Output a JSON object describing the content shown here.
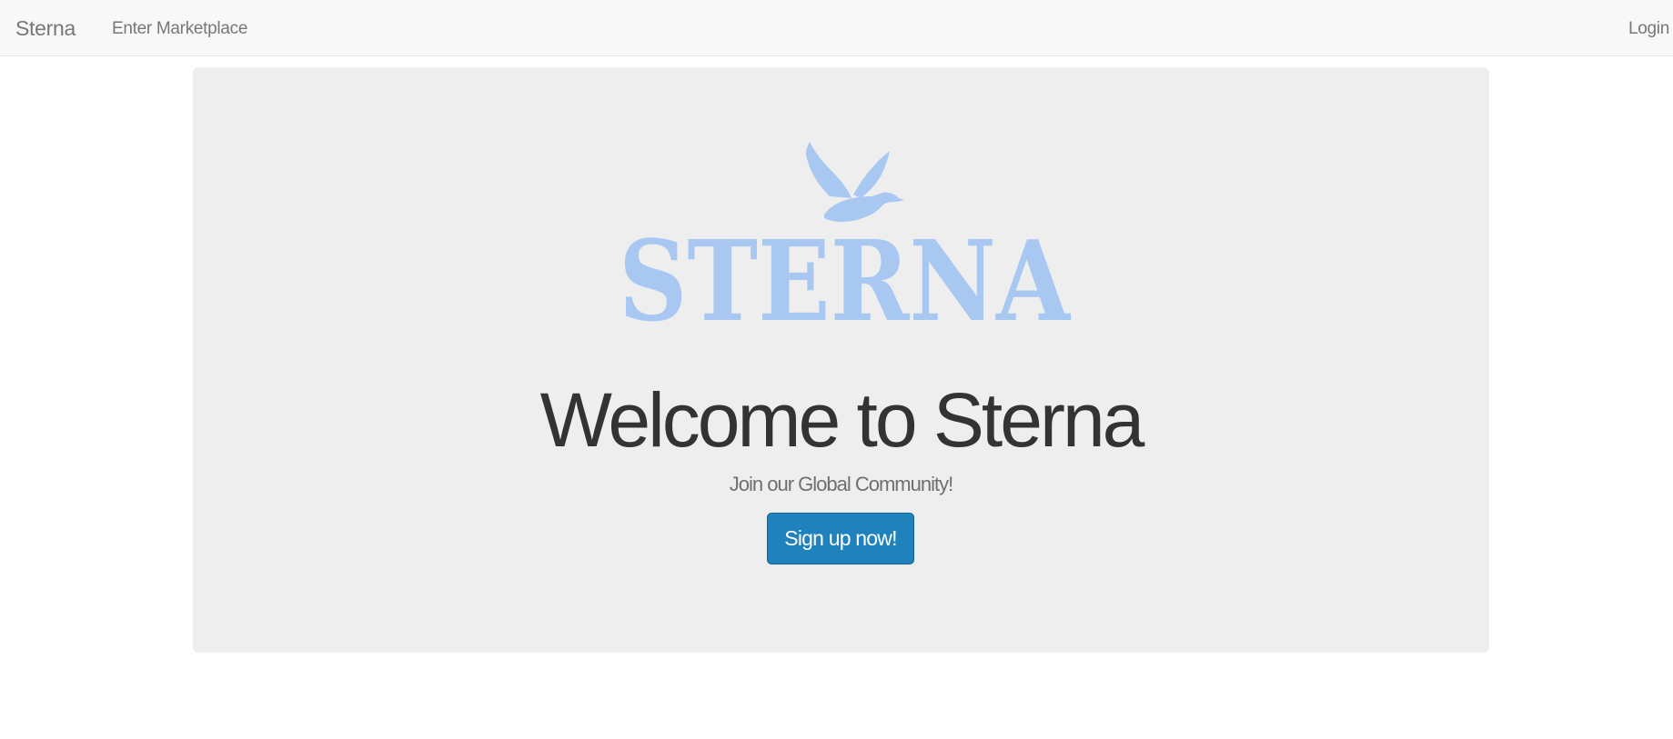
{
  "navbar": {
    "brand": "Sterna",
    "links": [
      {
        "label": "Enter Marketplace"
      },
      {
        "label": "Login"
      }
    ]
  },
  "hero": {
    "logo_icon": "bird-logo-icon",
    "logo_text": "STERNA",
    "logo_color": "#a8c8f2",
    "title": "Welcome to Sterna",
    "subtitle": "Join our Global Community!",
    "cta_label": "Sign up now!",
    "cta_color": "#1f82bd"
  }
}
